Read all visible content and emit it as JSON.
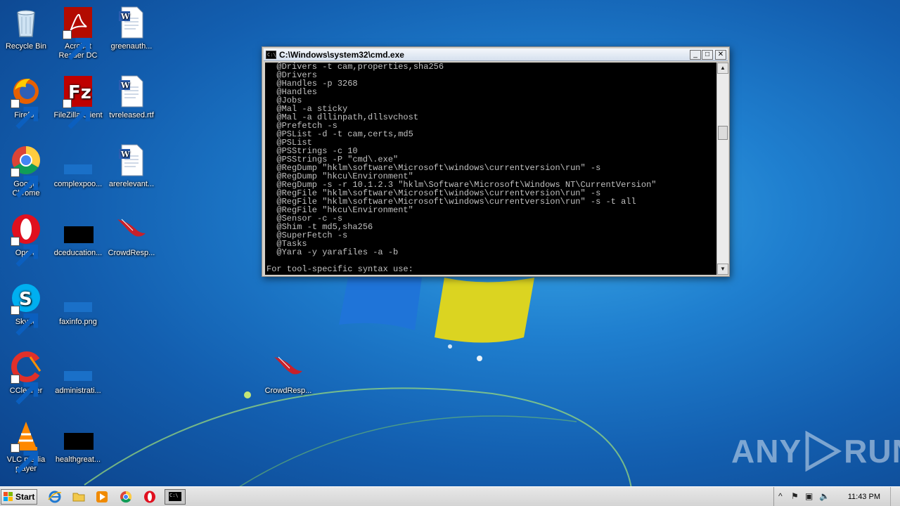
{
  "desktop": {
    "icons": [
      {
        "label": "Recycle Bin"
      },
      {
        "label": "Acrobat Reader DC"
      },
      {
        "label": "greenauth..."
      },
      {
        "label": "Firefox"
      },
      {
        "label": "FileZilla Client"
      },
      {
        "label": "tvreleased.rtf"
      },
      {
        "label": "Google Chrome"
      },
      {
        "label": "complexpoo..."
      },
      {
        "label": "arerelevant..."
      },
      {
        "label": "Opera"
      },
      {
        "label": "dceducation..."
      },
      {
        "label": "CrowdResp..."
      },
      {
        "label": "Skype"
      },
      {
        "label": "faxinfo.png"
      },
      {
        "label": "CCleaner"
      },
      {
        "label": "administrati..."
      },
      {
        "label": "CrowdResp..."
      },
      {
        "label": "VLC media player"
      },
      {
        "label": "healthgreat..."
      }
    ]
  },
  "cmd_window": {
    "title": "C:\\Windows\\system32\\cmd.exe",
    "title_icon": "C:\\",
    "buttons": {
      "minimize": "_",
      "maximize": "□",
      "close": "✕"
    },
    "lines": [
      "  @Drivers -t cam,properties,sha256",
      "  @Drivers",
      "  @Handles -p 3268",
      "  @Handles",
      "  @Jobs",
      "  @Mal -a sticky",
      "  @Mal -a dllinpath,dllsvchost",
      "  @Prefetch -s",
      "  @PSList -d -t cam,certs,md5",
      "  @PSList",
      "  @PSStrings -c 10",
      "  @PSStrings -P \"cmd\\.exe\"",
      "  @RegDump \"hklm\\software\\Microsoft\\windows\\currentversion\\run\" -s",
      "  @RegDump \"hkcu\\Environment\"",
      "  @RegDump -s -r 10.1.2.3 \"hklm\\Software\\Microsoft\\Windows NT\\CurrentVersion\"",
      "  @RegFile \"hklm\\software\\Microsoft\\windows\\currentversion\\run\" -s",
      "  @RegFile \"hklm\\software\\Microsoft\\windows\\currentversion\\run\" -s -t all",
      "  @RegFile \"hkcu\\Environment\"",
      "  @Sensor -c -s",
      "  @Shim -t md5,sha256",
      "  @SuperFetch -s",
      "  @Tasks",
      "  @Yara -y yarafiles -a -b",
      "",
      "For tool-specific syntax use:"
    ],
    "scroll_up": "▲",
    "scroll_down": "▼"
  },
  "watermark": {
    "left": "ANY",
    "right": "RUN"
  },
  "taskbar": {
    "start_label": "Start",
    "active_task_label": "C:\\",
    "tray_expand": "^",
    "clock": "11:43 PM"
  },
  "icons": {
    "recycle": "recycle-bin-icon",
    "acrobat": "acrobat-icon",
    "word": "word-document-icon",
    "firefox": "firefox-icon",
    "filezilla": "filezilla-icon",
    "chrome": "chrome-icon",
    "opera": "opera-icon",
    "skype": "skype-icon",
    "ccleaner": "ccleaner-icon",
    "vlc": "vlc-icon",
    "crowdresponse": "crowdresponse-icon"
  }
}
